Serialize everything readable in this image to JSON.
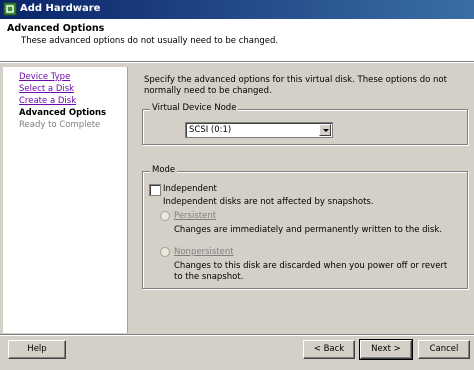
{
  "window": {
    "title": "Add Hardware"
  },
  "header": {
    "title": "Advanced Options",
    "subtitle": "These advanced options do not usually need to be changed."
  },
  "nav": {
    "items": [
      {
        "label": "Device Type",
        "state": "link"
      },
      {
        "label": "Select a Disk",
        "state": "link"
      },
      {
        "label": "Create a Disk",
        "state": "link"
      },
      {
        "label": "Advanced Options",
        "state": "current"
      },
      {
        "label": "Ready to Complete",
        "state": "disabled"
      }
    ]
  },
  "main": {
    "intro": "Specify the advanced options for this virtual disk. These options do not normally need to be changed.",
    "device_node": {
      "group_label": "Virtual Device Node",
      "selected": "SCSI (0:1)"
    },
    "mode": {
      "group_label": "Mode",
      "independent_label": "Independent",
      "independent_checked": false,
      "independent_desc": "Independent disks are not affected by snapshots.",
      "persistent_label": "Persistent",
      "persistent_desc": "Changes are immediately and permanently written to the disk.",
      "nonpersistent_label": "Nonpersistent",
      "nonpersistent_desc": "Changes to this disk are discarded when you power off or revert to the snapshot."
    }
  },
  "footer": {
    "help": "Help",
    "back": "< Back",
    "next": "Next >",
    "cancel": "Cancel"
  },
  "colors": {
    "titlebar_start": "#0a246a",
    "titlebar_end": "#3a6ea5",
    "link": "#6a0dad",
    "face": "#d4d0c8"
  }
}
